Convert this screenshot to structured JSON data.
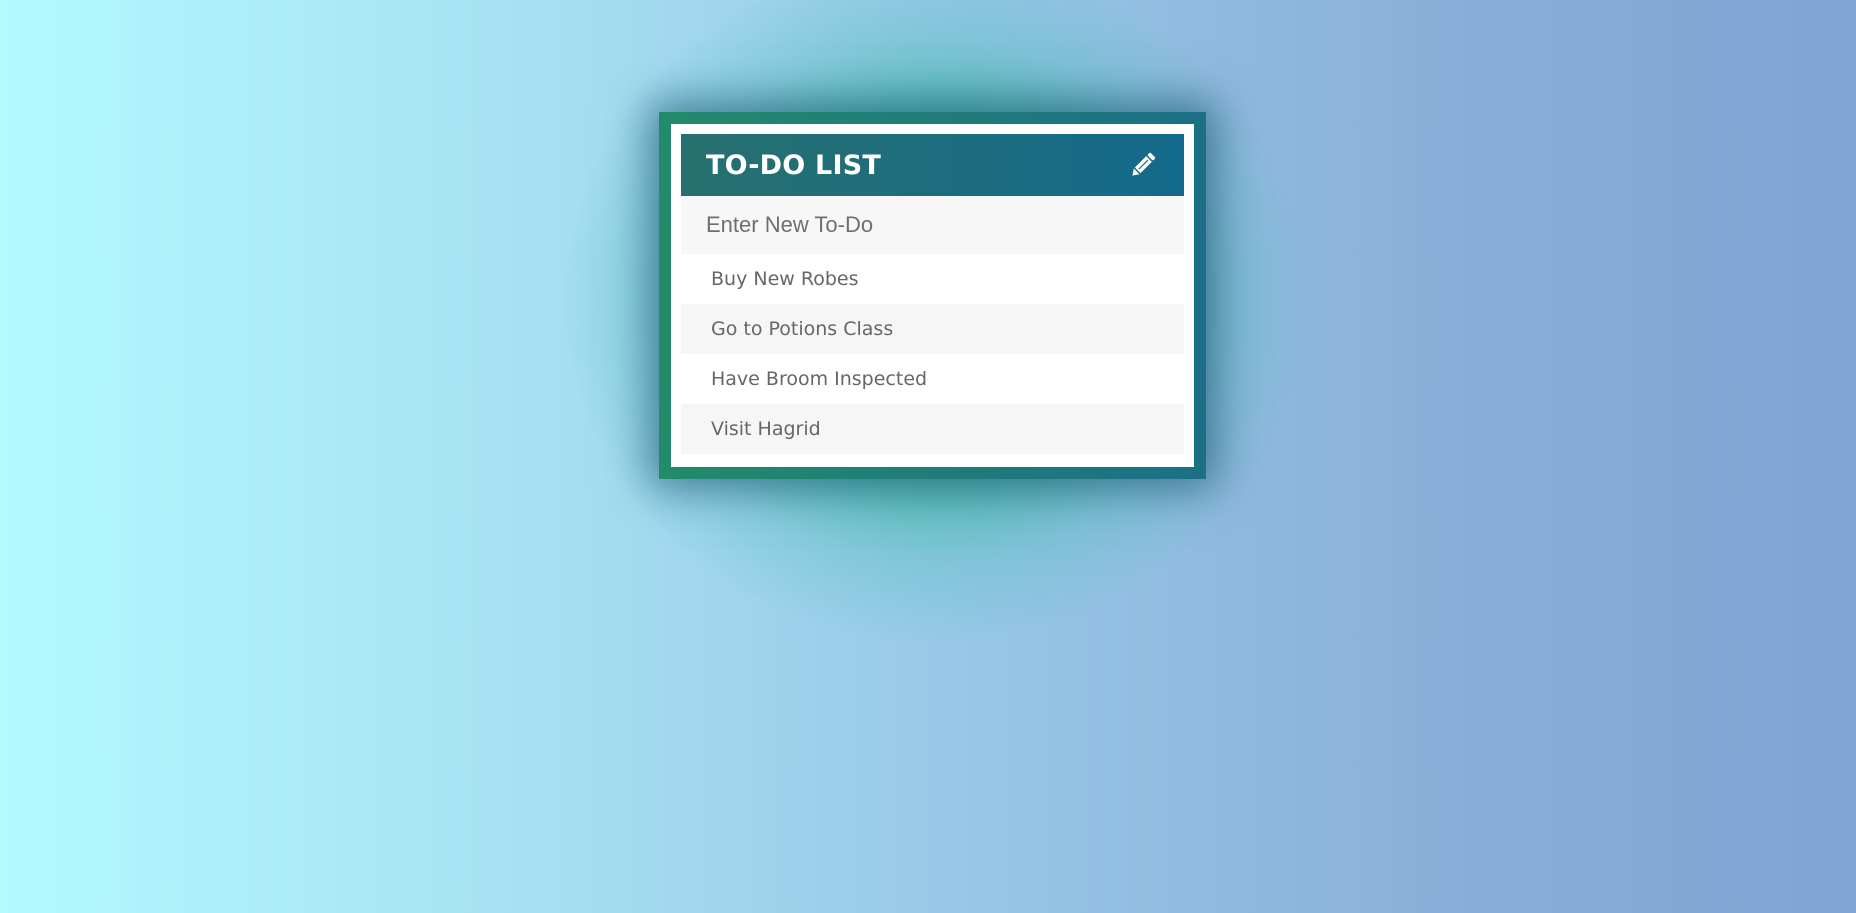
{
  "app": {
    "title": "TO-DO LIST",
    "edit_icon": "pencil-icon"
  },
  "input": {
    "placeholder": "Enter New To-Do",
    "value": ""
  },
  "todos": [
    {
      "label": "Buy New Robes"
    },
    {
      "label": "Go to Potions Class"
    },
    {
      "label": "Have Broom Inspected"
    },
    {
      "label": "Visit Hagrid"
    }
  ],
  "colors": {
    "header_start": "#27706f",
    "header_end": "#146a8c",
    "frame_start": "#238a6b",
    "frame_end": "#1c6f86"
  }
}
